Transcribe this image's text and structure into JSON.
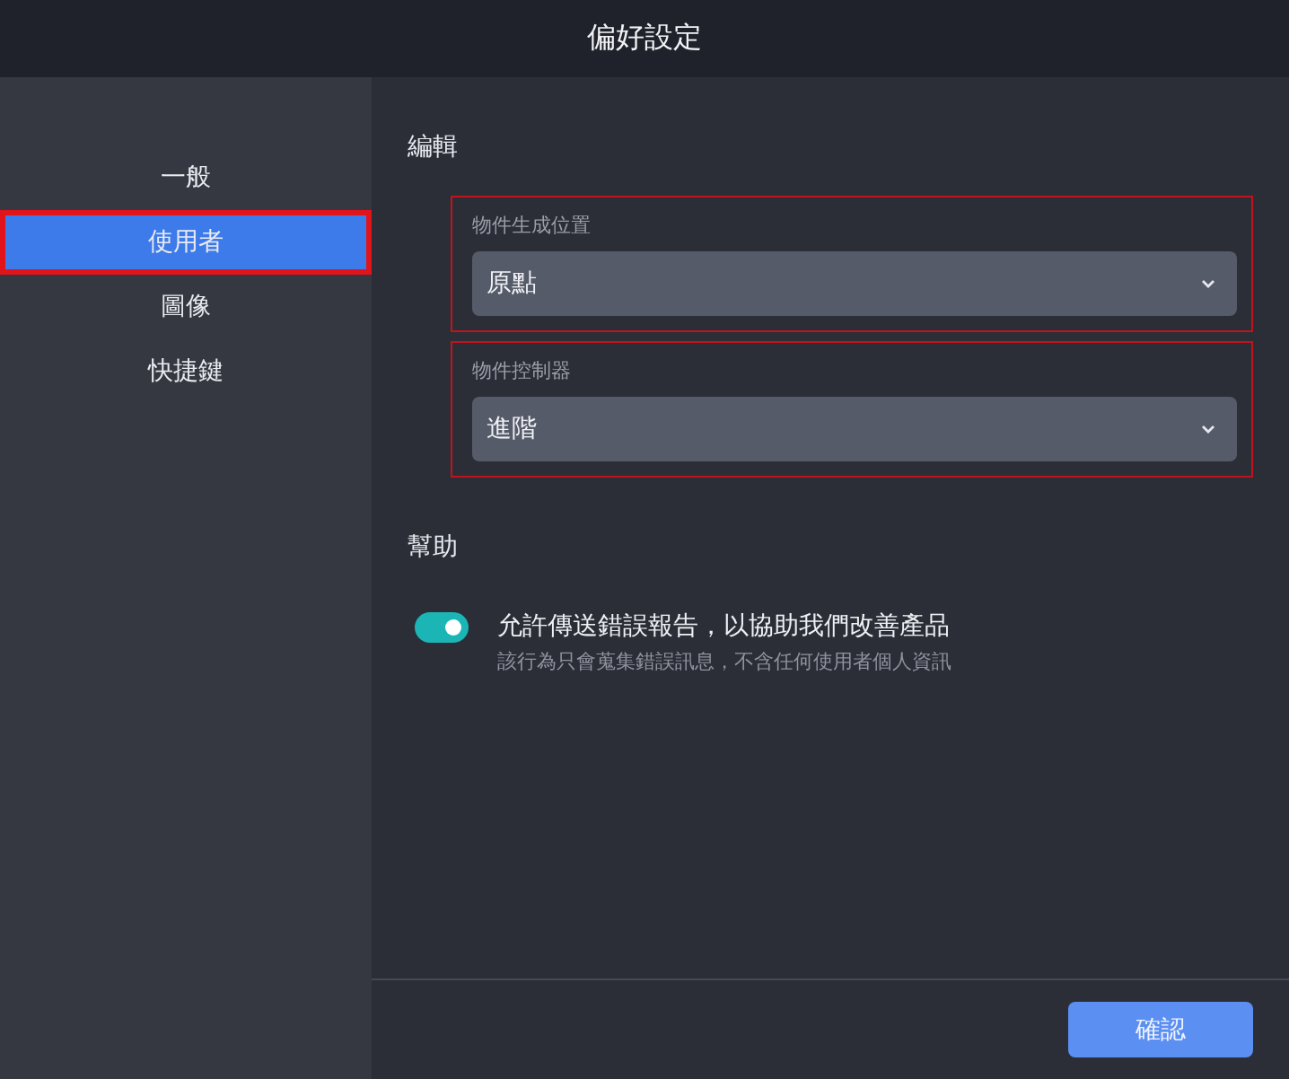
{
  "window": {
    "title": "偏好設定"
  },
  "sidebar": {
    "items": [
      {
        "label": "一般",
        "selected": false,
        "highlighted": false
      },
      {
        "label": "使用者",
        "selected": true,
        "highlighted": true
      },
      {
        "label": "圖像",
        "selected": false,
        "highlighted": false
      },
      {
        "label": "快捷鍵",
        "selected": false,
        "highlighted": false
      }
    ]
  },
  "sections": [
    {
      "title": "編輯",
      "fields": [
        {
          "label": "物件生成位置",
          "value": "原點",
          "highlighted": true
        },
        {
          "label": "物件控制器",
          "value": "進階",
          "highlighted": true
        }
      ]
    },
    {
      "title": "幫助",
      "toggles": [
        {
          "label": "允許傳送錯誤報告，以協助我們改善產品",
          "description": "該行為只會蒐集錯誤訊息，不含任何使用者個人資訊",
          "on": true
        }
      ]
    }
  ],
  "buttons": [
    "確認"
  ]
}
